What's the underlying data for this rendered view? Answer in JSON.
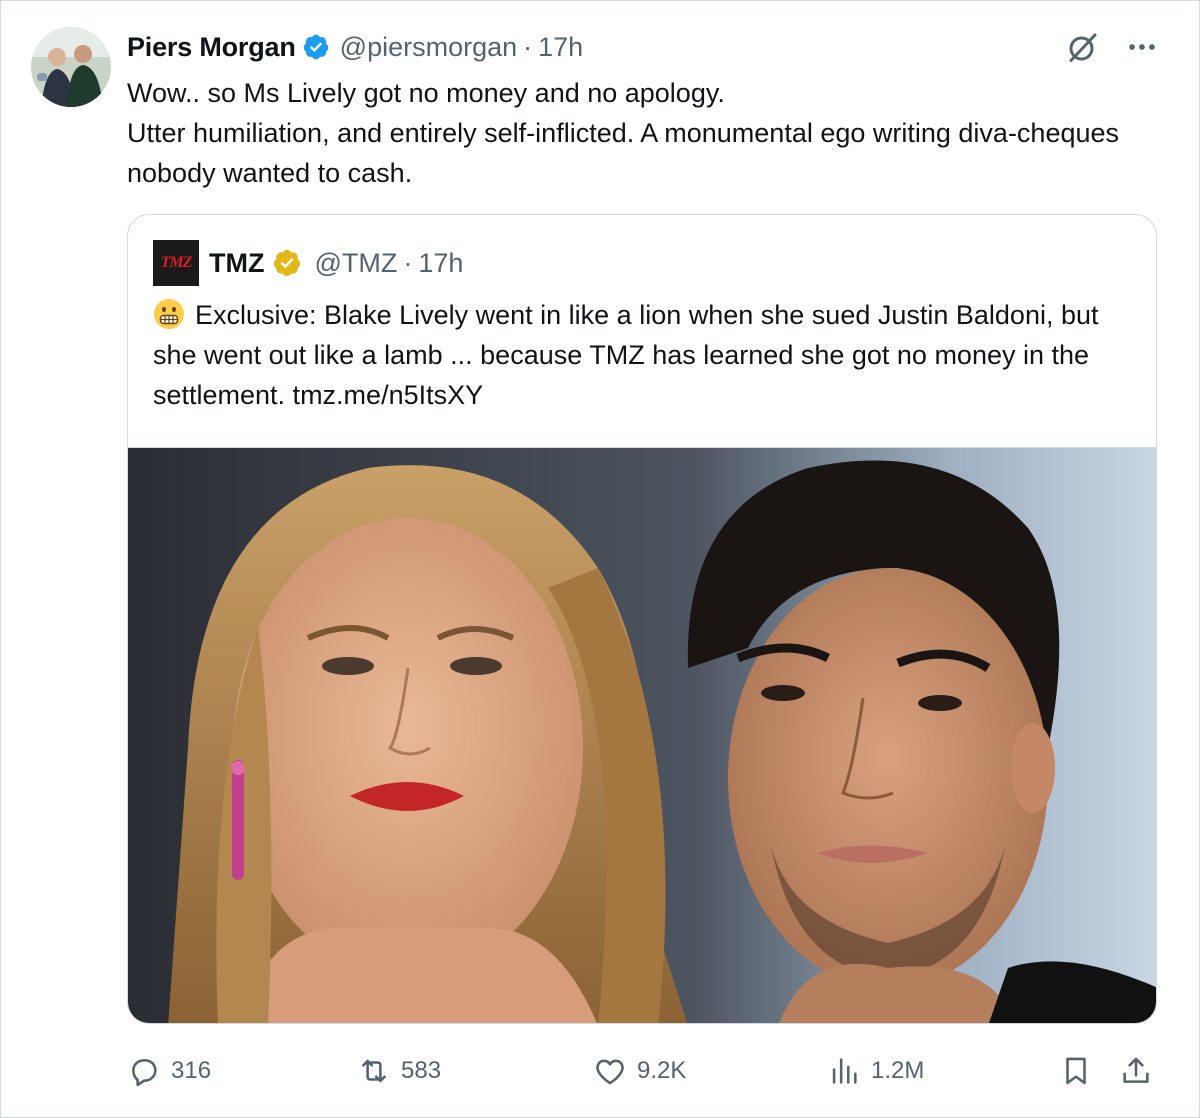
{
  "tweet": {
    "author": {
      "display_name": "Piers Morgan",
      "handle": "@piersmorgan",
      "time": "17h",
      "separator": "·",
      "verified_badge_color": "#1d9bf0"
    },
    "text_lines": [
      "Wow.. so Ms Lively got no money and no apology.",
      "Utter humiliation, and entirely self-inflicted. A monumental ego writing diva-cheques nobody wanted to cash."
    ],
    "top_icons": [
      "grok-icon",
      "more-icon"
    ]
  },
  "quote": {
    "author": {
      "logo_text": "TMZ",
      "display_name": "TMZ",
      "handle": "@TMZ",
      "time": "17h",
      "separator": "·",
      "verified_badge_color": "#e2b719"
    },
    "emoji": "grimacing-face",
    "text": "Exclusive: Blake Lively went in like a lion when she sued Justin Baldoni, but she went out like a lamb ... because TMZ has learned she got no money in the settlement. tmz.me/n5ItsXY"
  },
  "actions": {
    "replies": "316",
    "reposts": "583",
    "likes": "9.2K",
    "views": "1.2M"
  },
  "colors": {
    "text": "#0f1419",
    "secondary": "#536471",
    "border": "#cfd9de"
  }
}
